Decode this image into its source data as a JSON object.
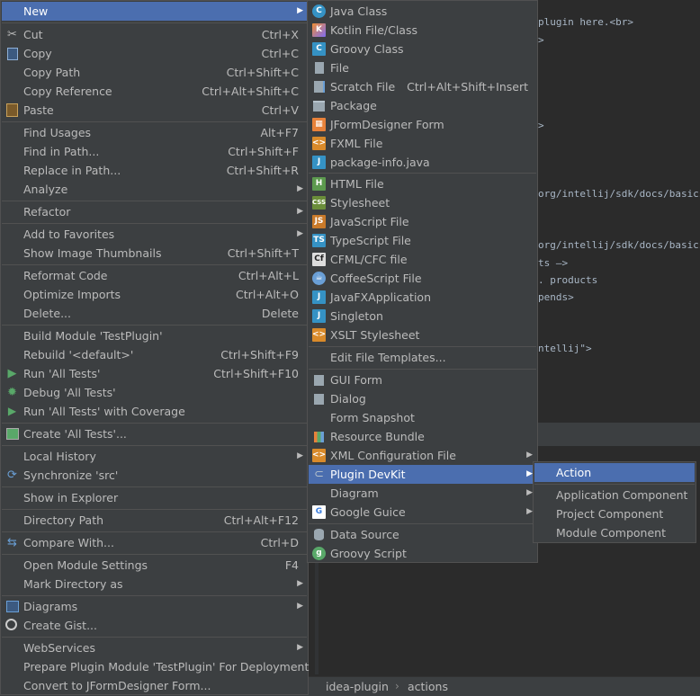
{
  "editor": {
    "code_lines": [
      "plugin here.<br>",
      ">",
      ">",
      "org/intellij/sdk/docs/basics/ge",
      "org/intellij/sdk/docs/basics/ge",
      "ts —>",
      ". products",
      "pends>",
      "ntellij\">"
    ]
  },
  "breadcrumb": {
    "items": [
      "idea-plugin",
      "actions"
    ],
    "separator": "›"
  },
  "context_menu": {
    "items": [
      {
        "label": "New",
        "shortcut": "",
        "submenu": true
      },
      {
        "label": "Cut",
        "shortcut": "Ctrl+X",
        "icon": "scissors-icon"
      },
      {
        "label": "Copy",
        "shortcut": "Ctrl+C",
        "icon": "copy-icon"
      },
      {
        "label": "Copy Path",
        "shortcut": "Ctrl+Shift+C"
      },
      {
        "label": "Copy Reference",
        "shortcut": "Ctrl+Alt+Shift+C"
      },
      {
        "label": "Paste",
        "shortcut": "Ctrl+V",
        "icon": "paste-icon"
      },
      {
        "label": "Find Usages",
        "shortcut": "Alt+F7"
      },
      {
        "label": "Find in Path...",
        "shortcut": "Ctrl+Shift+F"
      },
      {
        "label": "Replace in Path...",
        "shortcut": "Ctrl+Shift+R"
      },
      {
        "label": "Analyze",
        "shortcut": "",
        "submenu": true
      },
      {
        "label": "Refactor",
        "shortcut": "",
        "submenu": true
      },
      {
        "label": "Add to Favorites",
        "shortcut": "",
        "submenu": true
      },
      {
        "label": "Show Image Thumbnails",
        "shortcut": "Ctrl+Shift+T"
      },
      {
        "label": "Reformat Code",
        "shortcut": "Ctrl+Alt+L"
      },
      {
        "label": "Optimize Imports",
        "shortcut": "Ctrl+Alt+O"
      },
      {
        "label": "Delete...",
        "shortcut": "Delete"
      },
      {
        "label": "Build Module 'TestPlugin'",
        "shortcut": ""
      },
      {
        "label": "Rebuild '<default>'",
        "shortcut": "Ctrl+Shift+F9"
      },
      {
        "label": "Run 'All Tests'",
        "shortcut": "Ctrl+Shift+F10",
        "icon": "run-icon"
      },
      {
        "label": "Debug 'All Tests'",
        "shortcut": "",
        "icon": "debug-icon"
      },
      {
        "label": "Run 'All Tests' with Coverage",
        "shortcut": "",
        "icon": "coverage-icon"
      },
      {
        "label": "Create 'All Tests'...",
        "shortcut": "",
        "icon": "create-test-icon"
      },
      {
        "label": "Local History",
        "shortcut": "",
        "submenu": true
      },
      {
        "label": "Synchronize 'src'",
        "shortcut": "",
        "icon": "sync-icon"
      },
      {
        "label": "Show in Explorer",
        "shortcut": ""
      },
      {
        "label": "Directory Path",
        "shortcut": "Ctrl+Alt+F12"
      },
      {
        "label": "Compare With...",
        "shortcut": "Ctrl+D",
        "icon": "compare-icon"
      },
      {
        "label": "Open Module Settings",
        "shortcut": "F4"
      },
      {
        "label": "Mark Directory as",
        "shortcut": "",
        "submenu": true
      },
      {
        "label": "Diagrams",
        "shortcut": "",
        "submenu": true,
        "icon": "diagram-icon"
      },
      {
        "label": "Create Gist...",
        "shortcut": "",
        "icon": "github-icon"
      },
      {
        "label": "WebServices",
        "shortcut": "",
        "submenu": true
      },
      {
        "label": "Prepare Plugin Module 'TestPlugin' For Deployment",
        "shortcut": ""
      },
      {
        "label": "Convert to JFormDesigner Form...",
        "shortcut": ""
      }
    ]
  },
  "new_submenu": {
    "items": [
      {
        "label": "Java Class",
        "shortcut": "",
        "icon": "java-class-icon"
      },
      {
        "label": "Kotlin File/Class",
        "shortcut": "",
        "icon": "kotlin-icon"
      },
      {
        "label": "Groovy Class",
        "shortcut": "",
        "icon": "groovy-class-icon"
      },
      {
        "label": "File",
        "shortcut": "",
        "icon": "file-icon"
      },
      {
        "label": "Scratch File",
        "shortcut": "Ctrl+Alt+Shift+Insert",
        "icon": "scratch-file-icon"
      },
      {
        "label": "Package",
        "shortcut": "",
        "icon": "package-icon"
      },
      {
        "label": "JFormDesigner Form",
        "shortcut": "",
        "icon": "jformdesigner-icon"
      },
      {
        "label": "FXML File",
        "shortcut": "",
        "icon": "fxml-icon"
      },
      {
        "label": "package-info.java",
        "shortcut": "",
        "icon": "package-info-icon"
      },
      {
        "label": "HTML File",
        "shortcut": "",
        "icon": "html-icon"
      },
      {
        "label": "Stylesheet",
        "shortcut": "",
        "icon": "css-icon"
      },
      {
        "label": "JavaScript File",
        "shortcut": "",
        "icon": "js-icon"
      },
      {
        "label": "TypeScript File",
        "shortcut": "",
        "icon": "ts-icon"
      },
      {
        "label": "CFML/CFC file",
        "shortcut": "",
        "icon": "cfml-icon"
      },
      {
        "label": "CoffeeScript File",
        "shortcut": "",
        "icon": "coffeescript-icon"
      },
      {
        "label": "JavaFXApplication",
        "shortcut": "",
        "icon": "javafx-icon"
      },
      {
        "label": "Singleton",
        "shortcut": "",
        "icon": "singleton-icon"
      },
      {
        "label": "XSLT Stylesheet",
        "shortcut": "",
        "icon": "xslt-icon"
      },
      {
        "label": "Edit File Templates...",
        "shortcut": ""
      },
      {
        "label": "GUI Form",
        "shortcut": "",
        "icon": "gui-form-icon"
      },
      {
        "label": "Dialog",
        "shortcut": "",
        "icon": "dialog-icon"
      },
      {
        "label": "Form Snapshot",
        "shortcut": ""
      },
      {
        "label": "Resource Bundle",
        "shortcut": "",
        "icon": "resource-bundle-icon"
      },
      {
        "label": "XML Configuration File",
        "shortcut": "",
        "submenu": true,
        "icon": "xml-config-icon"
      },
      {
        "label": "Plugin DevKit",
        "shortcut": "",
        "submenu": true,
        "icon": "plugin-devkit-icon"
      },
      {
        "label": "Diagram",
        "shortcut": "",
        "submenu": true
      },
      {
        "label": "Google Guice",
        "shortcut": "",
        "submenu": true,
        "icon": "google-guice-icon"
      },
      {
        "label": "Data Source",
        "shortcut": "",
        "icon": "data-source-icon"
      },
      {
        "label": "Groovy Script",
        "shortcut": "",
        "icon": "groovy-script-icon"
      }
    ]
  },
  "devkit_submenu": {
    "items": [
      {
        "label": "Action"
      },
      {
        "label": "Application Component"
      },
      {
        "label": "Project Component"
      },
      {
        "label": "Module Component"
      }
    ]
  },
  "colors": {
    "menu_bg": "#3c3f41",
    "selection": "#4b6eaf",
    "editor_bg": "#2b2b2b",
    "text": "#bbbbbb"
  }
}
